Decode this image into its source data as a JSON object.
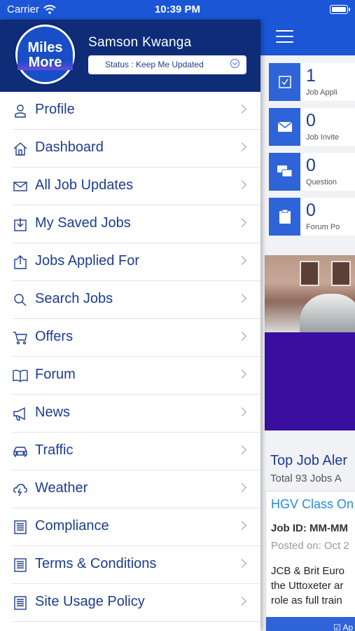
{
  "status_bar": {
    "carrier": "Carrier",
    "time": "10:39 PM"
  },
  "drawer": {
    "logo_line1": "Miles",
    "logo_line2": "More",
    "user_name": "Samson Kwanga",
    "status_text": "Status : Keep Me Updated",
    "menu": [
      {
        "label": "Profile",
        "icon": "user-icon"
      },
      {
        "label": "Dashboard",
        "icon": "home-icon"
      },
      {
        "label": "All Job Updates",
        "icon": "mail-icon"
      },
      {
        "label": "My Saved Jobs",
        "icon": "download-icon"
      },
      {
        "label": "Jobs Applied For",
        "icon": "upload-icon"
      },
      {
        "label": "Search Jobs",
        "icon": "search-icon"
      },
      {
        "label": "Offers",
        "icon": "cart-icon"
      },
      {
        "label": "Forum",
        "icon": "book-icon"
      },
      {
        "label": "News",
        "icon": "megaphone-icon"
      },
      {
        "label": "Traffic",
        "icon": "car-icon"
      },
      {
        "label": "Weather",
        "icon": "cloud-icon"
      },
      {
        "label": "Compliance",
        "icon": "document-icon"
      },
      {
        "label": "Terms & Conditions",
        "icon": "document-icon"
      },
      {
        "label": "Site Usage Policy",
        "icon": "document-icon"
      }
    ]
  },
  "background_app": {
    "stats": [
      {
        "value": "1",
        "label": "Job Appli"
      },
      {
        "value": "0",
        "label": "Job Invite"
      },
      {
        "value": "0",
        "label": "Question"
      },
      {
        "value": "0",
        "label": "Forum Po"
      }
    ],
    "alerts_title": "Top Job Aler",
    "alerts_subtitle": "Total 93 Jobs A",
    "job": {
      "title": "HGV Class On",
      "id": "Job ID: MM-MM",
      "posted": "Posted on: Oct 2",
      "desc_line1": "JCB & Brit Euro",
      "desc_line2": "the Uttoxeter ar",
      "desc_line3": "role as full train",
      "apply_label": "Ap"
    }
  }
}
